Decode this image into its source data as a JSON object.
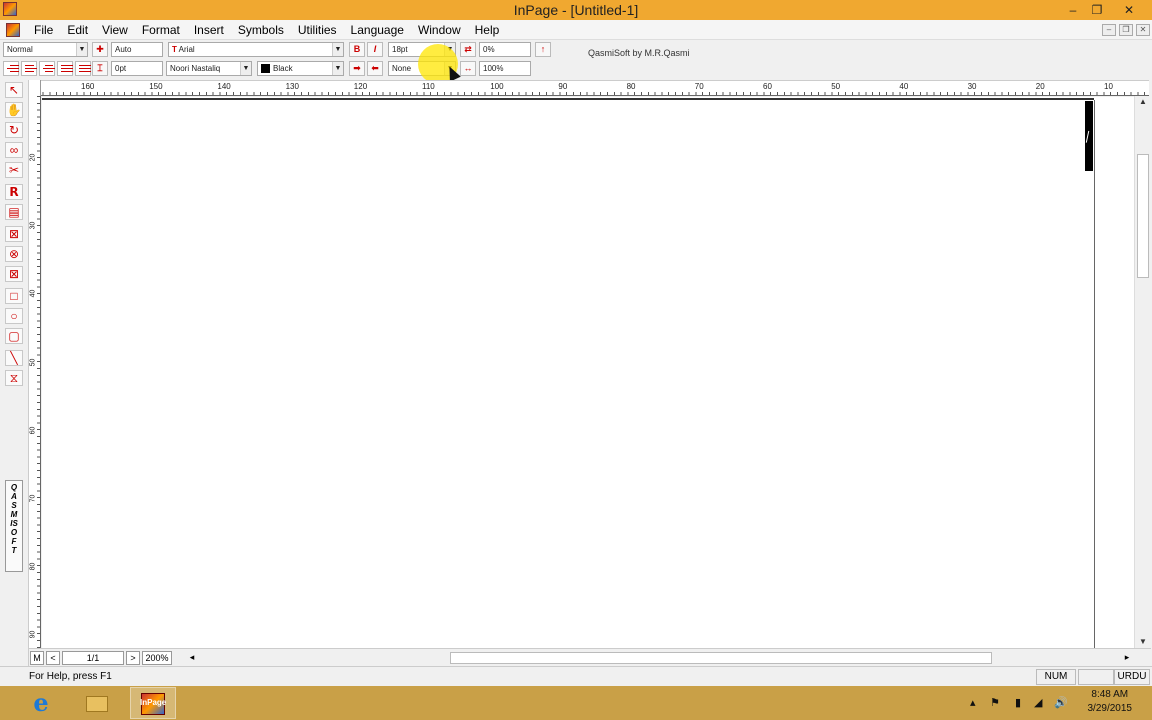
{
  "window": {
    "title": "InPage - [Untitled-1]"
  },
  "menu": [
    "File",
    "Edit",
    "View",
    "Format",
    "Insert",
    "Symbols",
    "Utilities",
    "Language",
    "Window",
    "Help"
  ],
  "toolbar": {
    "style_value": "Normal",
    "leading_value": "Auto",
    "font_value": "Arial",
    "size_value": "18pt",
    "spacing_value": "0%",
    "indent_value": "0pt",
    "urdu_font_value": "Noori Nastaliq",
    "color_value": "Black",
    "shade_value": "None",
    "scale_value": "100%",
    "bold_label": "B",
    "italic_label": "I",
    "brand": "QasmiSoft by M.R.Qasmi"
  },
  "ruler_h": [
    "160",
    "150",
    "140",
    "130",
    "120",
    "110",
    "100",
    "90",
    "80",
    "70",
    "60",
    "50",
    "40",
    "30",
    "20",
    "10"
  ],
  "ruler_v": [
    "20",
    "30",
    "40",
    "50",
    "60",
    "70",
    "80",
    "90"
  ],
  "palette": {
    "brand_vertical": "QASMISOFT"
  },
  "navigation": {
    "master_label": "M",
    "prev_label": "<",
    "page_value": "1/1",
    "next_label": ">",
    "zoom_value": "200%"
  },
  "status": {
    "help_text": "For Help, press F1",
    "num": "NUM",
    "lang": "URDU"
  },
  "taskbar": {
    "ie_label": "e",
    "inpage_label": "InPage",
    "time": "8:48 AM",
    "date": "3/29/2015"
  },
  "colors": {
    "titlebar": "#f0a830",
    "taskbar": "#c9a047",
    "accent_red": "#cc0000"
  }
}
